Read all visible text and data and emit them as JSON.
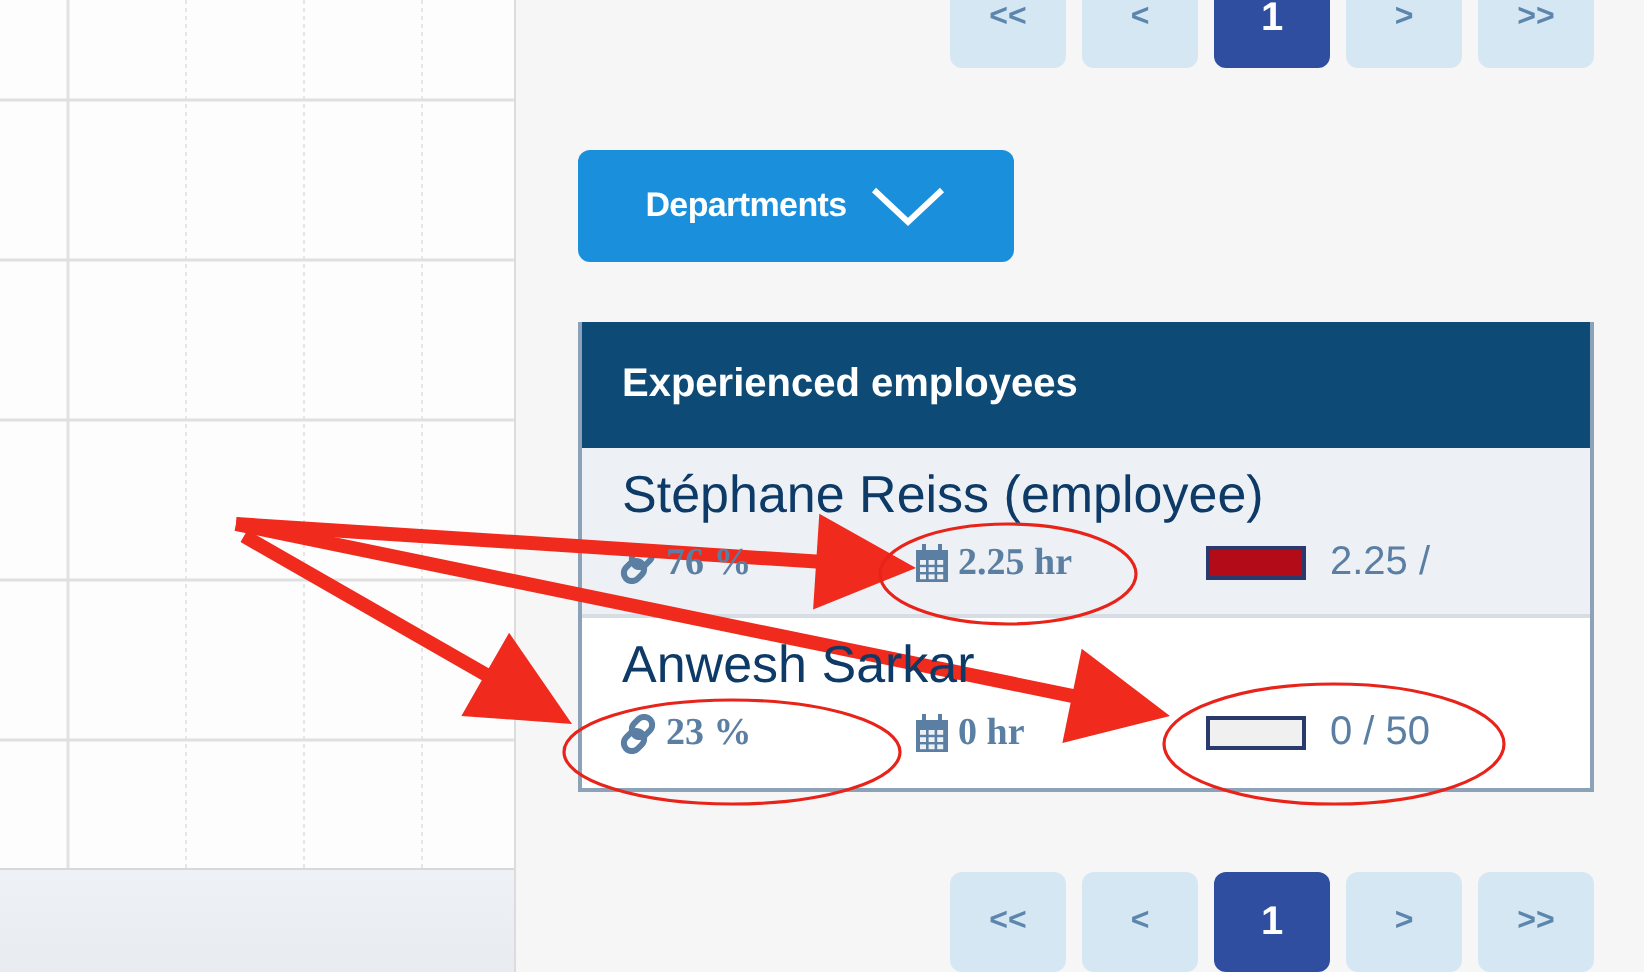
{
  "pagination_top": [
    {
      "label": "<<",
      "selected": false
    },
    {
      "label": "<",
      "selected": false
    },
    {
      "label": "1",
      "selected": true
    },
    {
      "label": ">",
      "selected": false
    },
    {
      "label": ">>",
      "selected": false
    }
  ],
  "departments_button": {
    "label": "Departments"
  },
  "employees_table": {
    "title": "Experienced employees",
    "rows": [
      {
        "name": "Stéphane Reiss (employee)",
        "share": "76 %",
        "hours": "2.25 hr",
        "level": 1,
        "reading": "2.25 /"
      },
      {
        "name": "Anwesh Sarkar",
        "share": "23 %",
        "hours": "0 hr",
        "level": 0,
        "reading": "0 / 50"
      }
    ]
  },
  "pagination_bottom": [
    {
      "label": "<<",
      "selected": false
    },
    {
      "label": "<",
      "selected": false
    },
    {
      "label": "1",
      "selected": true
    },
    {
      "label": ">",
      "selected": false
    },
    {
      "label": ">>",
      "selected": false
    }
  ],
  "annotations": [
    {
      "kind": "arrow"
    },
    {
      "kind": "arrow"
    },
    {
      "kind": "arrow"
    },
    {
      "kind": "ellipse"
    },
    {
      "kind": "ellipse"
    },
    {
      "kind": "ellipse"
    }
  ]
}
